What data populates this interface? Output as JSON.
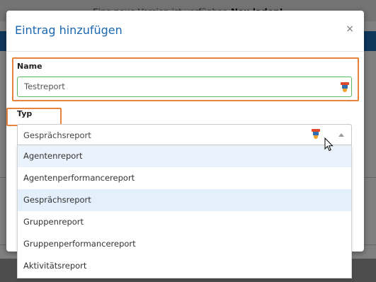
{
  "background": {
    "banner_text": "Eine neue Version ist verfügbar.",
    "banner_link": "Neu laden!"
  },
  "modal": {
    "title": "Eintrag hinzufügen",
    "close_label": "×"
  },
  "name_field": {
    "label": "Name",
    "value": "Testreport"
  },
  "type_field": {
    "label": "Typ",
    "selected": "Gesprächsreport",
    "options": [
      "Agentenreport",
      "Agentenperformancereport",
      "Gesprächsreport",
      "Gruppenreport",
      "Gruppenperformancereport",
      "Aktivitätsreport"
    ],
    "highlighted_index": 0,
    "selected_index": 2
  },
  "colors": {
    "accent": "#1b66b0",
    "highlight_border": "#e8833a",
    "valid_border": "#5cb85c"
  }
}
